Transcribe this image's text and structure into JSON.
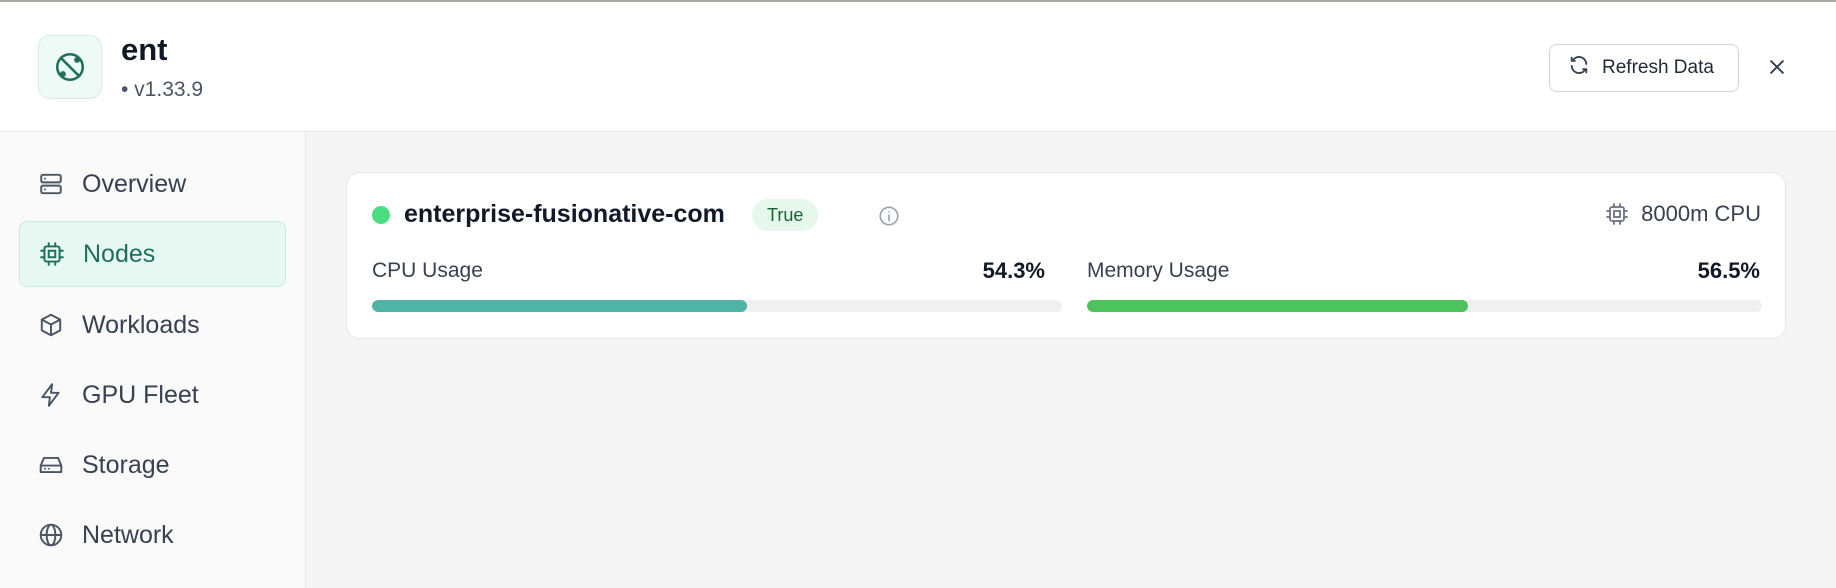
{
  "header": {
    "app_name": "ent",
    "version": "• v1.33.9",
    "refresh_label": "Refresh Data",
    "icons": {
      "app": "cluster-icon",
      "refresh": "refresh-icon",
      "close": "close-icon"
    }
  },
  "sidebar": {
    "active": "Nodes",
    "items": [
      {
        "label": "Overview",
        "icon": "server-icon"
      },
      {
        "label": "Nodes",
        "icon": "cpu-chip-icon"
      },
      {
        "label": "Workloads",
        "icon": "package-icon"
      },
      {
        "label": "GPU Fleet",
        "icon": "lightning-icon"
      },
      {
        "label": "Storage",
        "icon": "hard-drive-icon"
      },
      {
        "label": "Network",
        "icon": "globe-icon"
      }
    ]
  },
  "node": {
    "name": "enterprise-fusionative-com",
    "status_badge": "True",
    "status_color": "#4ade80",
    "cpu_capacity": "8000m CPU",
    "cpu": {
      "label": "CPU Usage",
      "value_text": "54.3%",
      "percent": 54.3,
      "color": "#4fb3a5"
    },
    "memory": {
      "label": "Memory Usage",
      "value_text": "56.5%",
      "percent": 56.5,
      "color": "#4cc35c"
    }
  },
  "colors": {
    "accent": "#1f6f5c",
    "active_nav_bg": "#e6f8f1"
  }
}
